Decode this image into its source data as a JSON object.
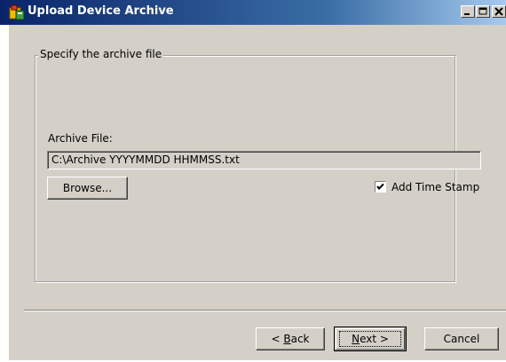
{
  "window": {
    "title": "Upload Device Archive",
    "icon": "app-archive-icon"
  },
  "group": {
    "legend": "Specify the archive file"
  },
  "archive": {
    "label": "Archive File:",
    "value": "C:\\Archive YYYYMMDD HHMMSS.txt"
  },
  "buttons": {
    "browse": "Browse...",
    "back_pre": "< ",
    "back_mnemonic": "B",
    "back_post": "ack",
    "next_mnemonic": "N",
    "next_post": "ext >",
    "cancel": "Cancel"
  },
  "timestamp": {
    "label": "Add Time Stamp",
    "checked": true
  },
  "colors": {
    "title_start": "#0a246a",
    "title_end": "#a6caf0",
    "face": "#d4d0c8"
  }
}
